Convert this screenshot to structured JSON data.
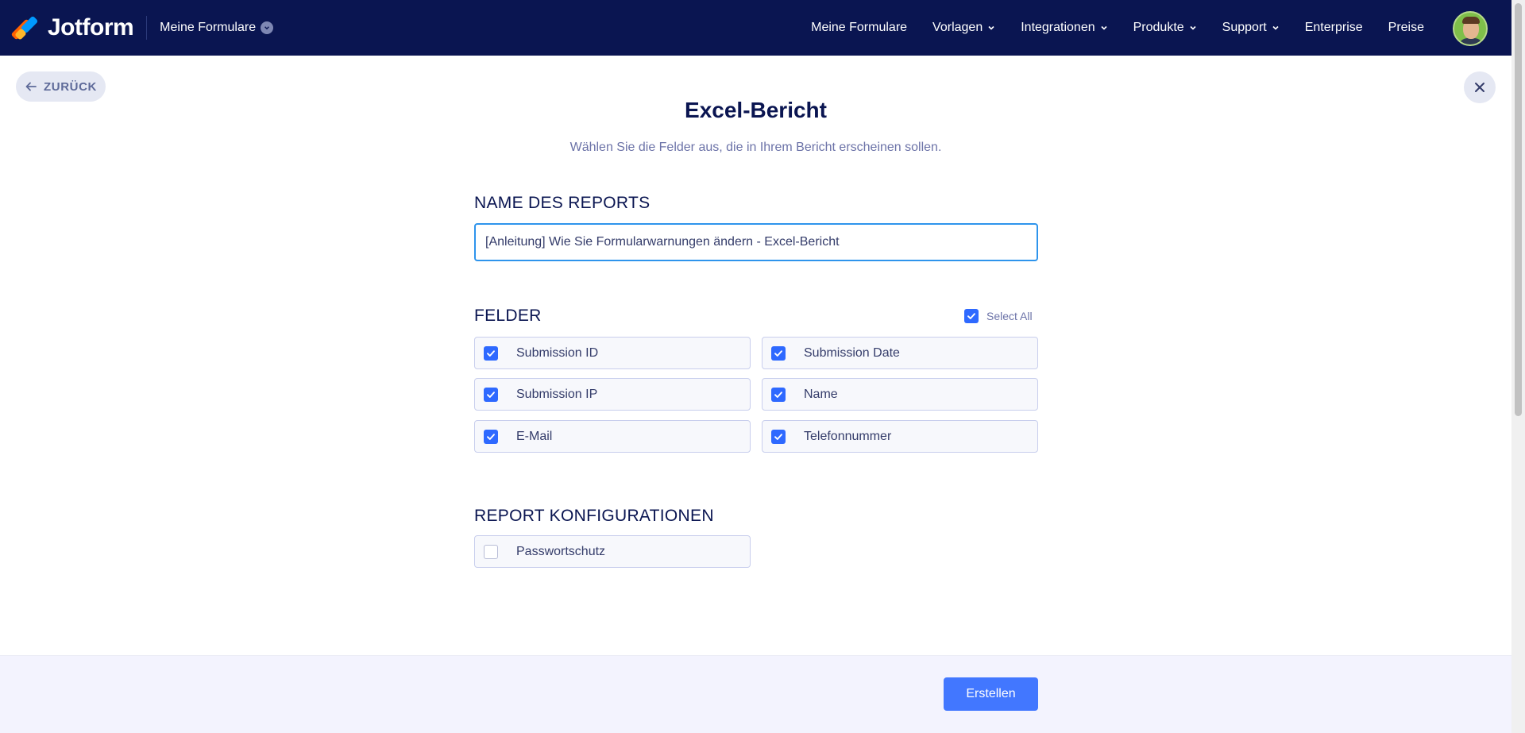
{
  "nav": {
    "brand": "Jotform",
    "my_forms_menu": "Meine Formulare",
    "links": [
      {
        "label": "Meine Formulare",
        "dropdown": false
      },
      {
        "label": "Vorlagen",
        "dropdown": true
      },
      {
        "label": "Integrationen",
        "dropdown": true
      },
      {
        "label": "Produkte",
        "dropdown": true
      },
      {
        "label": "Support",
        "dropdown": true
      },
      {
        "label": "Enterprise",
        "dropdown": false
      },
      {
        "label": "Preise",
        "dropdown": false
      }
    ]
  },
  "back_button": "ZURÜCK",
  "page": {
    "title": "Excel-Bericht",
    "subtitle": "Wählen Sie die Felder aus, die in Ihrem Bericht erscheinen sollen."
  },
  "report_name": {
    "label": "NAME DES REPORTS",
    "value": "[Anleitung] Wie Sie Formularwarnungen ändern - Excel-Bericht"
  },
  "fields": {
    "label": "FELDER",
    "select_all": {
      "label": "Select All",
      "checked": true
    },
    "items": [
      {
        "label": "Submission ID",
        "checked": true
      },
      {
        "label": "Submission Date",
        "checked": true
      },
      {
        "label": "Submission IP",
        "checked": true
      },
      {
        "label": "Name",
        "checked": true
      },
      {
        "label": "E-Mail",
        "checked": true
      },
      {
        "label": "Telefonnummer",
        "checked": true
      }
    ]
  },
  "config": {
    "label": "REPORT KONFIGURATIONEN",
    "items": [
      {
        "label": "Passwortschutz",
        "checked": false
      }
    ]
  },
  "create_button": "Erstellen",
  "colors": {
    "nav_bg": "#0a1551",
    "accent": "#4277ff",
    "checkbox": "#2e69ff",
    "input_focus": "#2e94ec"
  }
}
